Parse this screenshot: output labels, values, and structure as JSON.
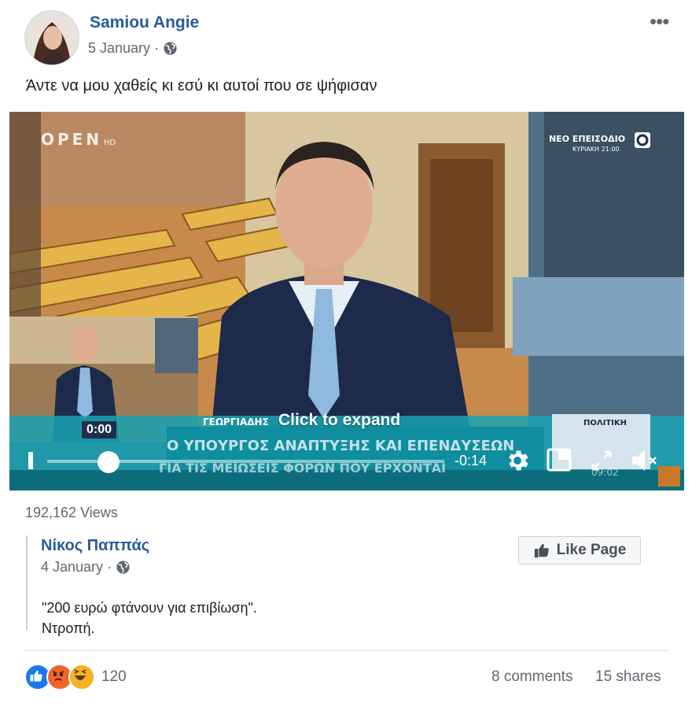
{
  "post": {
    "author": "Samiou Angie",
    "date": "5 January",
    "meta_separator": "·",
    "text": "Άντε να μου χαθείς κι εσύ κι αυτοί που σε ψήφισαν",
    "more_label": "•••"
  },
  "video": {
    "overlay_text": "Click to expand",
    "current_time": "0:00",
    "remaining_time": "-0:14",
    "progress_fraction": 0.0,
    "channel_logo_text": "OPEN",
    "channel_logo_sub": "HD",
    "promo_line1": "ΝΕΟ ΕΠΕΙΣΟΔΙΟ",
    "promo_line2": "ΚΥΡΙΑΚΗ 21:00",
    "lower_third_name": "ΓΕΩΡΓΙΑΔΗΣ",
    "lower_third_line1": "Ο ΥΠΟΥΡΓΟΣ ΑΝΑΠΤΥΞΗΣ ΚΑΙ ΕΠΕΝΔΥΣΕΩΝ",
    "lower_third_line2": "ΓΙΑ ΤΙΣ ΜΕΙΩΣΕΙΣ ΦΟΡΩΝ ΠΟΥ ΕΡΧΟΝΤΑΙ",
    "section_label": "ΠΟΛΙΤΙΚΗ",
    "clock": "09:02"
  },
  "stats": {
    "views": "192,162 Views",
    "reaction_count": "120",
    "comments": "8 comments",
    "shares": "15 shares"
  },
  "shared": {
    "author": "Νίκος Παππάς",
    "date": "4 January",
    "meta_separator": "·",
    "text_line1": "\"200 ευρώ φτάνουν για επιβίωση\".",
    "text_line2": "Ντροπή.",
    "like_page_label": "Like Page"
  },
  "colors": {
    "link_blue": "#2a5a9d",
    "meta_gray": "#606770",
    "like_blue": "#1877f2",
    "angry_orange": "#f0642a",
    "haha_yellow": "#f7b125"
  }
}
